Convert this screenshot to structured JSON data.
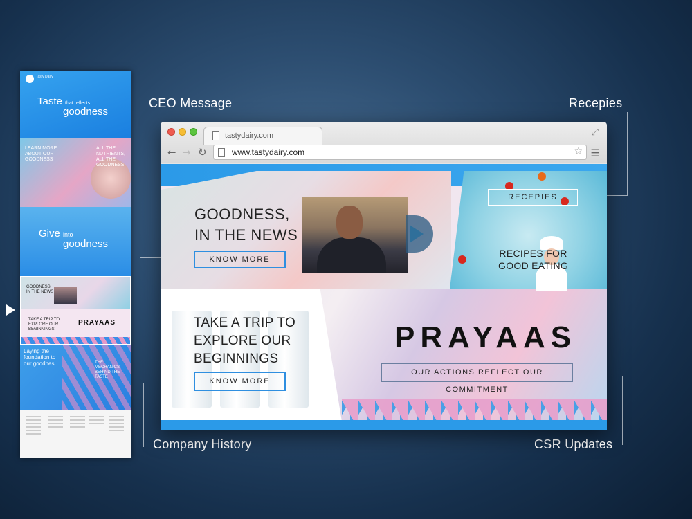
{
  "callouts": {
    "ceo": "CEO Message",
    "recipes": "Recepies",
    "history": "Company History",
    "csr": "CSR Updates"
  },
  "browser": {
    "tab_title": "tastydairy.com",
    "url": "www.tastydairy.com",
    "icons": [
      "back-icon",
      "forward-icon",
      "reload-icon",
      "page-icon",
      "star-icon",
      "menu-icon",
      "expand-icon"
    ]
  },
  "site": {
    "news_title_line1": "GOODNESS,",
    "news_title_line2": "IN THE NEWS",
    "news_button": "KNOW MORE",
    "recipes_button": "RECEPIES",
    "recipes_title_line1": "RECIPES FOR",
    "recipes_title_line2": "GOOD EATING",
    "trip_line1": "TAKE A TRIP TO",
    "trip_line2": "EXPLORE OUR",
    "trip_line3": "BEGINNINGS",
    "trip_button": "KNOW MORE",
    "prayaas": "PRAYAAS",
    "csr_tagline": "OUR ACTIONS REFLECT OUR COMMITMENT"
  },
  "strip": {
    "logo_text": "Tasty Dairy",
    "s1_line1": "Taste",
    "s1_line1_small": "that reflects",
    "s1_line2": "goodness",
    "s2_left": "LEARN MORE ABOUT OUR GOODNESS",
    "s2_right": "ALL THE NUTRIENTS, ALL THE GOODNESS",
    "s3_line1": "Give",
    "s3_line1_small": "into",
    "s3_line2": "goodness",
    "s4_news": "GOODNESS, IN THE NEWS",
    "s4_trip": "TAKE A TRIP TO EXPLORE OUR BEGINNINGS",
    "s4_prayaas": "PRAYAAS",
    "s5_left": "Laying the foundation to our goodnes",
    "s5_right": "THE MECHANICS BEHIND THE TASTE"
  },
  "colors": {
    "accent_blue": "#2b9ae8",
    "accent_pink": "#e7a0cc"
  }
}
